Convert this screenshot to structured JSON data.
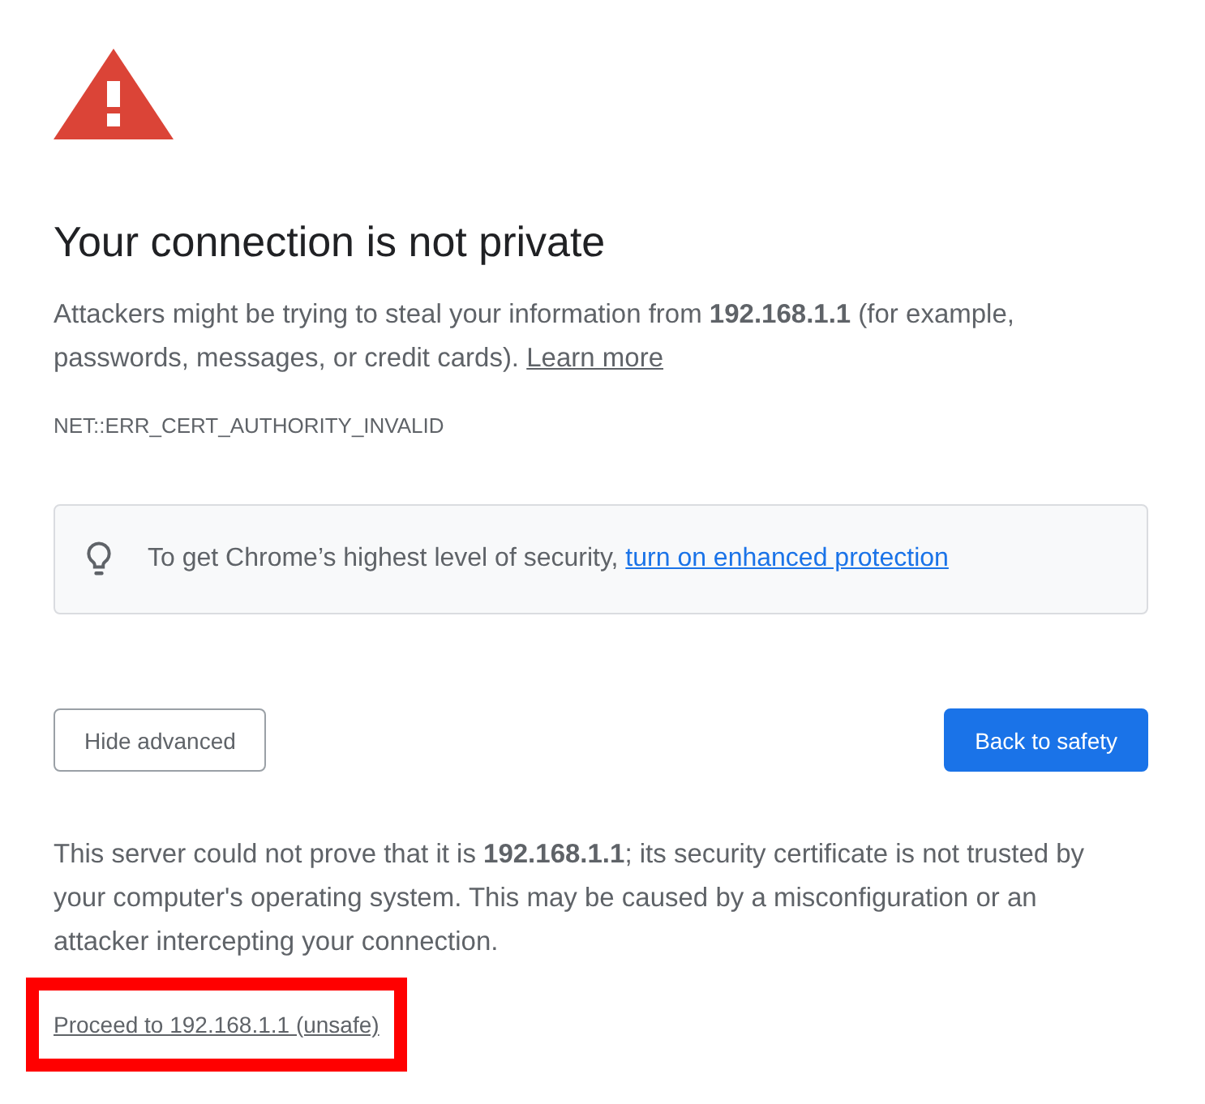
{
  "heading": "Your connection is not private",
  "explanation": {
    "text": "Attackers might be trying to steal your information from **192.168.1.1** (for example, passwords, messages, or credit cards).",
    "link": "Learn more"
  },
  "error_code": "NET::ERR_CERT_AUTHORITY_INVALID",
  "enhanced_protection": {
    "text": "To get Chrome’s highest level of security,",
    "link": "turn on enhanced protection"
  },
  "buttons": [
    {
      "label": "Hide advanced",
      "kind": "secondary"
    },
    {
      "label": "Back to safety",
      "kind": "primary"
    }
  ],
  "details": "This server could not prove that it is **192.168.1.1**; its security certificate is not trusted by your computer's operating system. This may be caused by a misconfiguration or an attacker intercepting your connection.",
  "proceed_link": {
    "label": "Proceed to 192.168.1.1 (unsafe)",
    "highlighted": true
  }
}
